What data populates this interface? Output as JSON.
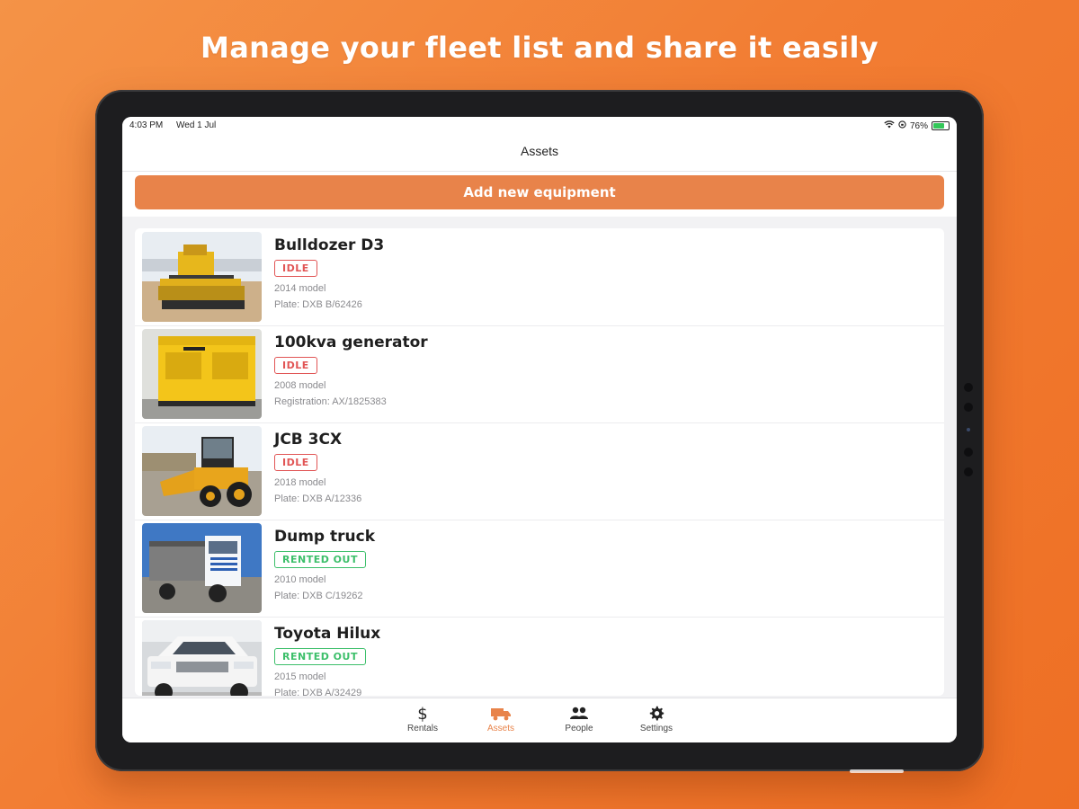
{
  "headline": "Manage your fleet list and share it easily",
  "status_bar": {
    "time": "4:03 PM",
    "date": "Wed 1 Jul",
    "battery": "76%"
  },
  "nav": {
    "title": "Assets"
  },
  "actions": {
    "add_equipment": "Add new equipment"
  },
  "assets": [
    {
      "name": "Bulldozer D3",
      "status": "IDLE",
      "status_type": "idle",
      "model": "2014 model",
      "id_line": "Plate: DXB B/62426",
      "thumb": "bulldozer"
    },
    {
      "name": "100kva generator",
      "status": "IDLE",
      "status_type": "idle",
      "model": "2008 model",
      "id_line": "Registration: AX/1825383",
      "thumb": "generator"
    },
    {
      "name": "JCB 3CX",
      "status": "IDLE",
      "status_type": "idle",
      "model": "2018 model",
      "id_line": "Plate: DXB A/12336",
      "thumb": "backhoe"
    },
    {
      "name": "Dump truck",
      "status": "RENTED OUT",
      "status_type": "rented",
      "model": "2010 model",
      "id_line": "Plate: DXB C/19262",
      "thumb": "truck"
    },
    {
      "name": "Toyota Hilux",
      "status": "RENTED OUT",
      "status_type": "rented",
      "model": "2015 model",
      "id_line": "Plate: DXB A/32429",
      "thumb": "pickup"
    }
  ],
  "tabs": [
    {
      "label": "Rentals",
      "icon": "dollar-icon",
      "active": false
    },
    {
      "label": "Assets",
      "icon": "truck-icon",
      "active": true
    },
    {
      "label": "People",
      "icon": "people-icon",
      "active": false
    },
    {
      "label": "Settings",
      "icon": "gear-icon",
      "active": false
    }
  ],
  "colors": {
    "background": "#f27d33",
    "accent": "#e8834a",
    "idle": "#e15555",
    "rented": "#3cbf6a",
    "device": "#1d1d1f"
  }
}
